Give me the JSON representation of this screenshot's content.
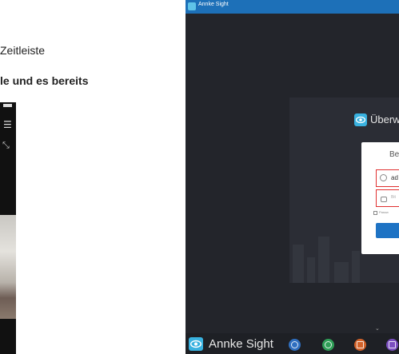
{
  "document": {
    "line1": "Zeitleiste",
    "line2": "le und es bereits"
  },
  "phone": {
    "menu_icon": "menu-icon",
    "fullscreen_icon": "fullscreen-icon",
    "menu_glyph": "☰",
    "fullscreen_glyph": "⤡"
  },
  "app": {
    "title": "Annke Sight",
    "welcome": "Überw",
    "login": {
      "title": "Be",
      "username": "ad",
      "password_placeholder": "Bit",
      "remember": "Passw"
    },
    "taskbar": {
      "brand": "Annke Sight",
      "chevron": "⌄",
      "buttons": [
        {
          "icon": "playback-icon",
          "color": "#2f6fc0"
        },
        {
          "icon": "refresh-icon",
          "color": "#2f9e57"
        },
        {
          "icon": "calendar-icon",
          "color": "#d2622a"
        },
        {
          "icon": "gallery-icon",
          "color": "#7b4fc0"
        }
      ]
    },
    "colors": {
      "titlebar": "#1d70b8",
      "background": "#23252b",
      "accent": "#39b2e0",
      "field_border": "#e03030",
      "login_button": "#1e73c4"
    }
  }
}
